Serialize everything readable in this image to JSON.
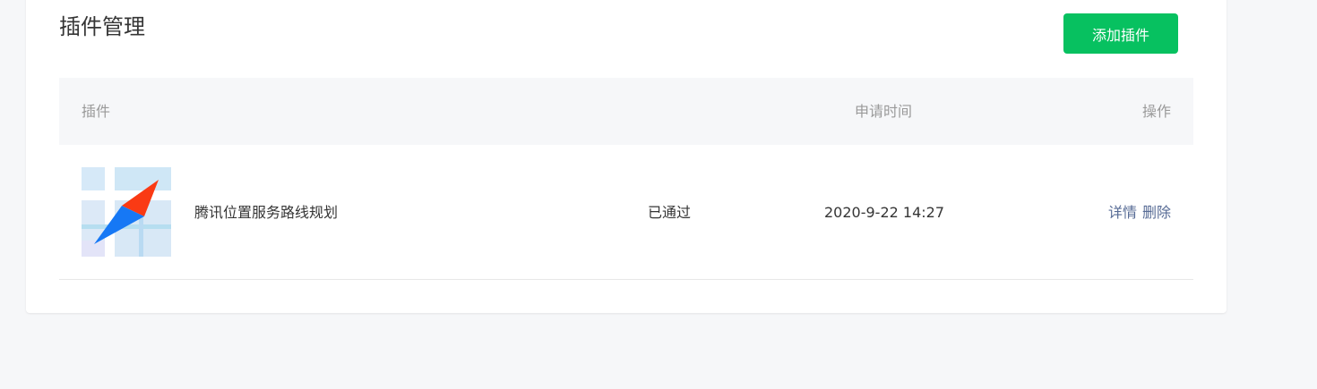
{
  "header": {
    "title": "插件管理",
    "add_button_label": "添加插件"
  },
  "table": {
    "columns": {
      "plugin": "插件",
      "apply_time": "申请时间",
      "action": "操作"
    },
    "rows": [
      {
        "icon": "tencent-map-route-planning-icon",
        "name": "腾讯位置服务路线规划",
        "status": "已通过",
        "apply_time": "2020-9-22 14:27",
        "actions": [
          "详情",
          "删除"
        ]
      }
    ]
  },
  "colors": {
    "primary_green": "#07c160",
    "link_blue": "#576b95",
    "text_main": "#353535",
    "text_muted": "#9a9a9a",
    "header_bg": "#f6f7f9"
  }
}
